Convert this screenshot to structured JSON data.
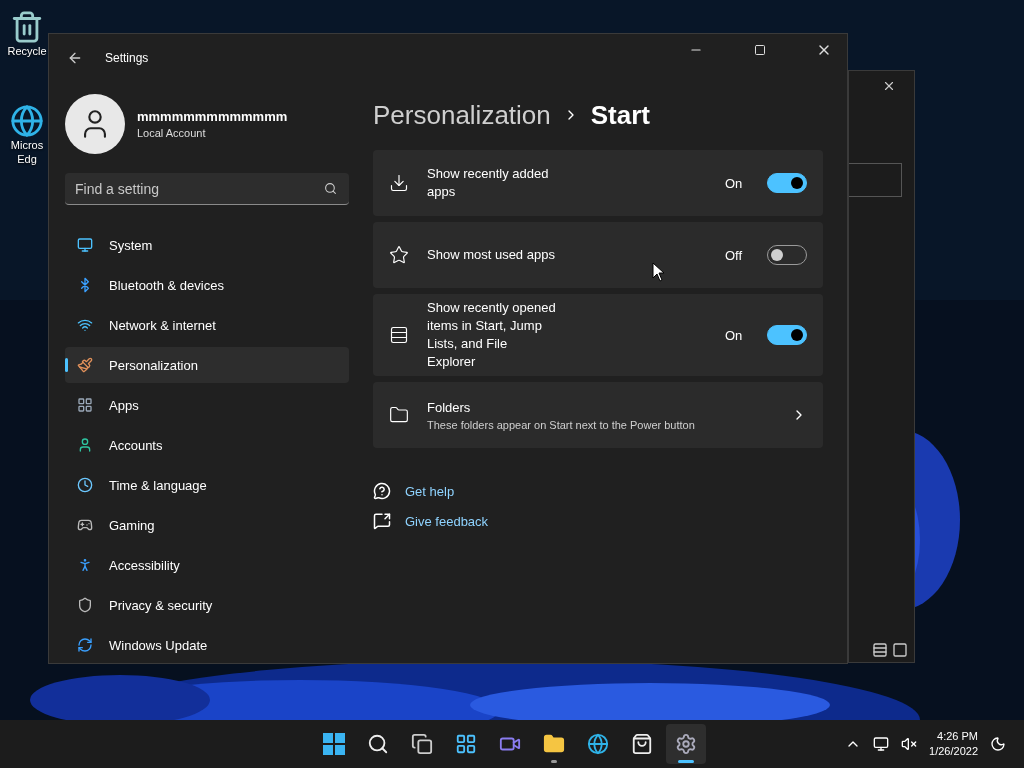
{
  "desktop_icons": [
    {
      "lines": [
        "Recycle"
      ]
    },
    {
      "lines": [
        "Micros",
        "Edg"
      ]
    }
  ],
  "window": {
    "title": "Settings"
  },
  "account": {
    "name": "mmmmmmmmmmmmm",
    "type": "Local Account"
  },
  "search": {
    "placeholder": "Find a setting"
  },
  "nav": [
    {
      "label": "System",
      "selected": false
    },
    {
      "label": "Bluetooth & devices",
      "selected": false
    },
    {
      "label": "Network & internet",
      "selected": false
    },
    {
      "label": "Personalization",
      "selected": true
    },
    {
      "label": "Apps",
      "selected": false
    },
    {
      "label": "Accounts",
      "selected": false
    },
    {
      "label": "Time & language",
      "selected": false
    },
    {
      "label": "Gaming",
      "selected": false
    },
    {
      "label": "Accessibility",
      "selected": false
    },
    {
      "label": "Privacy & security",
      "selected": false
    },
    {
      "label": "Windows Update",
      "selected": false
    }
  ],
  "breadcrumb": {
    "parent": "Personalization",
    "current": "Start"
  },
  "cards": [
    {
      "kind": "toggle",
      "label": "Show recently added apps",
      "state": "On",
      "on": true
    },
    {
      "kind": "toggle",
      "label": "Show most used apps",
      "state": "Off",
      "on": false
    },
    {
      "kind": "toggle",
      "label": "Show recently opened items in Start, Jump Lists, and File Explorer",
      "state": "On",
      "on": true
    },
    {
      "kind": "link",
      "label": "Folders",
      "description": "These folders appear on Start next to the Power button"
    }
  ],
  "links": [
    "Get help",
    "Give feedback"
  ],
  "taskbar": {
    "apps": [
      {
        "kind": "start",
        "open": false,
        "selected": false
      },
      {
        "kind": "search",
        "open": false,
        "selected": false
      },
      {
        "kind": "taskview",
        "open": false,
        "selected": false
      },
      {
        "kind": "widgets",
        "open": false,
        "selected": false
      },
      {
        "kind": "chat",
        "open": false,
        "selected": false
      },
      {
        "kind": "explorer",
        "open": true,
        "selected": false
      },
      {
        "kind": "edge",
        "open": false,
        "selected": false
      },
      {
        "kind": "store",
        "open": false,
        "selected": false
      },
      {
        "kind": "settings",
        "open": true,
        "selected": true
      }
    ],
    "time": "4:26 PM",
    "date": "1/26/2022"
  }
}
